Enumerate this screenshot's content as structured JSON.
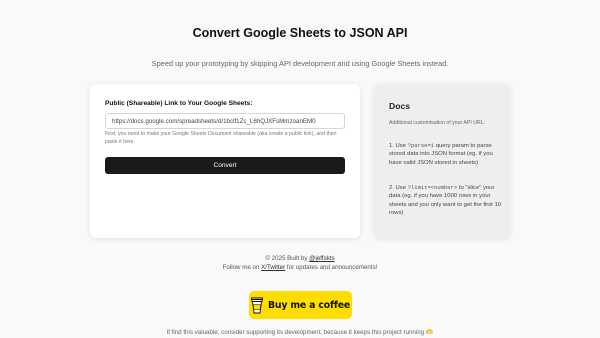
{
  "header": {
    "title": "Convert Google Sheets to JSON API",
    "subtitle": "Speed up your prototyping by skipping API development and using Google Sheets instead."
  },
  "form": {
    "label": "Public (Shareable) Link to Your Google Sheets:",
    "input_value": "https://docs.google.com/spreadsheets/d/1bclf1Zc_L6hQJXFsMmzoanEM0",
    "help_text": "First, you need to make your Google Sheets Document shareable (aka create a public link), and then paste it here.",
    "convert_label": "Convert"
  },
  "docs": {
    "title": "Docs",
    "intro": "Additional customisation of your API URL:",
    "item1": {
      "prefix": "1. Use ",
      "code": "?parse=1",
      "text": " query param to parse stored data into JSON format (eg. if you have valid JSON stored in sheets)"
    },
    "item2": {
      "prefix": "2. Use ",
      "code": "?limit=<number>",
      "text": " to \"slice\" your data (eg. if you have 1000 rows in your sheets and you only want to get the first 10 rows)"
    }
  },
  "footer": {
    "built_by_prefix": "© 2025 Built by ",
    "author": "@jeffskts",
    "follow_prefix": "Follow me on ",
    "twitter": "X/Twitter",
    "follow_suffix": " for updates and announcements!"
  },
  "bmc": {
    "label": "Buy me a coffee",
    "icon": "coffee-cup-icon",
    "color": "#ffdd00"
  },
  "support": {
    "text": "If find this valuable, consider supporting its development, because it keeps this project running ",
    "heart": "🫶"
  }
}
